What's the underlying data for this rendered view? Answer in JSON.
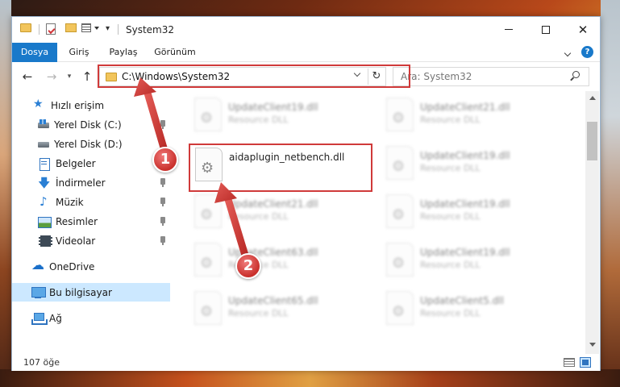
{
  "window": {
    "title": "System32",
    "controls": {
      "minimize": "—",
      "maximize": "☐",
      "close": "✕"
    }
  },
  "ribbon": {
    "tabs": [
      {
        "label": "Dosya",
        "active": true
      },
      {
        "label": "Giriş"
      },
      {
        "label": "Paylaş"
      },
      {
        "label": "Görünüm"
      }
    ],
    "help": "?"
  },
  "nav": {
    "back": "←",
    "forward": "→",
    "up": "↑",
    "address": "C:\\Windows\\System32",
    "refresh": "↻",
    "search_placeholder": "Ara: System32"
  },
  "sidebar": {
    "items": [
      {
        "label": "Hızlı erişim",
        "icon": "star-icon"
      },
      {
        "label": "Yerel Disk (C:)",
        "icon": "drive-icon",
        "pinned": true
      },
      {
        "label": "Yerel Disk (D:)",
        "icon": "drive-icon"
      },
      {
        "label": "Belgeler",
        "icon": "documents-icon",
        "pinned": true
      },
      {
        "label": "İndirmeler",
        "icon": "download-icon",
        "pinned": true
      },
      {
        "label": "Müzik",
        "icon": "music-icon",
        "pinned": true
      },
      {
        "label": "Resimler",
        "icon": "pictures-icon",
        "pinned": true
      },
      {
        "label": "Videolar",
        "icon": "videos-icon",
        "pinned": true
      },
      {
        "label": "OneDrive",
        "icon": "cloud-icon"
      },
      {
        "label": "Bu bilgisayar",
        "icon": "computer-icon",
        "selected": true
      },
      {
        "label": "Ağ",
        "icon": "network-icon"
      }
    ]
  },
  "files": {
    "highlighted": {
      "name": "aidaplugin_netbench.dll"
    },
    "left_column": [
      {
        "name": "UpdateClient19.dll",
        "type": "Resource DLL"
      },
      {
        "name": "UpdateClient21.dll",
        "type": "Resource DLL"
      },
      {
        "name": "UpdateClient63.dll",
        "type": "Resource DLL"
      },
      {
        "name": "UpdateClient65.dll",
        "type": "Resource DLL"
      }
    ],
    "right_column": [
      {
        "name": "UpdateClient21.dll",
        "type": "Resource DLL"
      },
      {
        "name": "UpdateClient19.dll",
        "type": "Resource DLL"
      },
      {
        "name": "UpdateClient19.dll",
        "type": "Resource DLL"
      },
      {
        "name": "UpdateClient19.dll",
        "type": "Resource DLL"
      },
      {
        "name": "UpdateClient5.dll",
        "type": "Resource DLL"
      }
    ]
  },
  "status": {
    "item_count": "107 öğe"
  },
  "annotations": {
    "step1": "1",
    "step2": "2"
  },
  "colors": {
    "accent": "#1979ca",
    "highlight": "#d03a3a",
    "selected_bg": "#cce8ff"
  }
}
